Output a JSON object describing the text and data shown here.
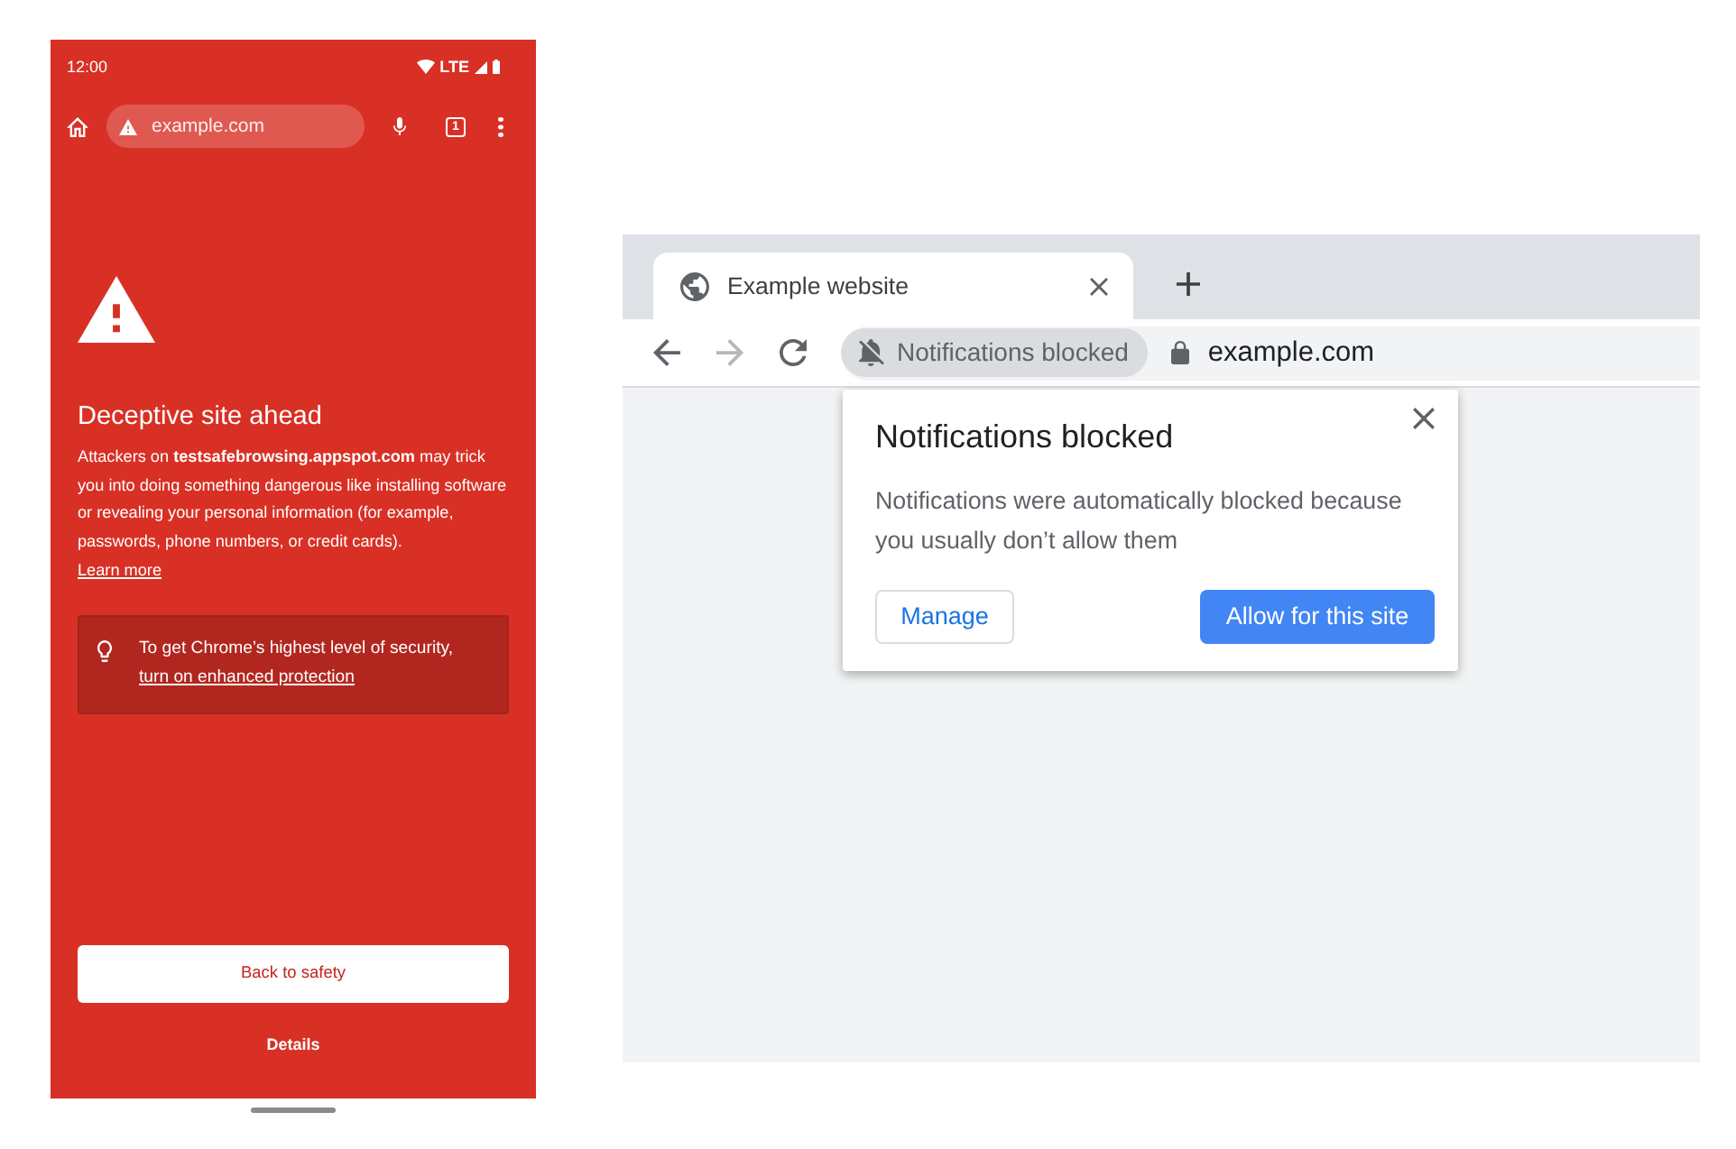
{
  "phone": {
    "status_bar": {
      "time": "12:00",
      "network": "LTE"
    },
    "toolbar": {
      "url": "example.com",
      "tab_count": "1"
    },
    "interstitial": {
      "title": "Deceptive site ahead",
      "body": "Attackers on **testsafebrowsing.appspot.com** may trick you into doing something dangerous like installing software or revealing your personal information (for example, passwords, phone numbers, or credit cards).",
      "learn_more": "Learn more",
      "tip": {
        "text": "To get Chrome’s highest level of security,",
        "link": "turn on enhanced protection"
      },
      "primary_button": "Back to safety",
      "secondary_button": "Details"
    }
  },
  "browser": {
    "tabs": [
      {
        "title": "Example website",
        "selected": true
      }
    ],
    "toolbar": {
      "nav_buttons": [
        {
          "kind": "back",
          "disabled": false
        },
        {
          "kind": "forward",
          "disabled": true
        },
        {
          "kind": "reload",
          "disabled": false
        }
      ],
      "chip": "Notifications blocked",
      "url": "example.com"
    },
    "popup": {
      "title": "Notifications blocked",
      "body": "Notifications were automatically blocked because you usually don’t allow them",
      "buttons": [
        {
          "label": "Manage",
          "kind": "secondary"
        },
        {
          "label": "Allow for this site",
          "kind": "primary"
        }
      ]
    }
  }
}
